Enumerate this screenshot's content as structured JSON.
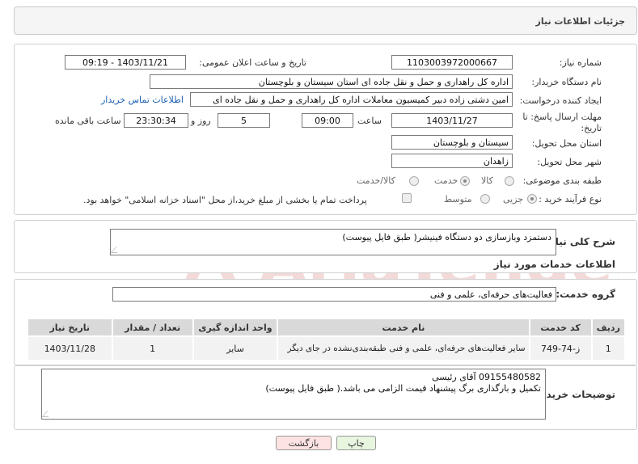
{
  "header": {
    "title": "جزئیات اطلاعات نیاز"
  },
  "form": {
    "need_number_label": "شماره نیاز:",
    "need_number": "1103003972000667",
    "announce_label": "تاریخ و ساعت اعلان عمومی:",
    "announce_value": "1403/11/21 - 09:19",
    "buyer_org_label": "نام دستگاه خریدار:",
    "buyer_org": "اداره کل راهداری و حمل و نقل جاده ای استان سیستان و بلوچستان",
    "requester_label": "ایجاد کننده درخواست:",
    "requester": "امین دشتی زاده دبیر کمیسیون معاملات اداره کل راهداری و حمل و نقل جاده ای",
    "contact_link": "اطلاعات تماس خریدار",
    "deadline_label": "مهلت ارسال پاسخ: تا تاریخ:",
    "deadline_date": "1403/11/27",
    "time_label": "ساعت",
    "deadline_time": "09:00",
    "days_value": "5",
    "days_label": "روز و",
    "remaining_time": "23:30:34",
    "remaining_label": "ساعت باقی مانده",
    "province_label": "استان محل تحویل:",
    "province": "سیستان و بلوچستان",
    "city_label": "شهر محل تحویل:",
    "city": "زاهدان",
    "category_label": "طبقه بندی موضوعی:",
    "category_options": [
      "کالا",
      "خدمت",
      "کالا/خدمت"
    ],
    "category_selected": "خدمت",
    "process_label": "نوع فرآیند خرید :",
    "process_options": [
      "جزیی",
      "متوسط"
    ],
    "process_selected": "جزیی",
    "treasury_note": "پرداخت تمام یا بخشی از مبلغ خرید،از محل \"اسناد خزانه اسلامی\" خواهد بود."
  },
  "summary": {
    "label": "شرح کلی نیاز:",
    "text": "دستمزد وبازسازی دو دستگاه فینیشر( طبق فایل پیوست)"
  },
  "services": {
    "title": "اطلاعات خدمات مورد نیاز",
    "group_label": "گروه خدمت:",
    "group_value": "فعالیت‌های حرفه‌ای، علمی و فنی",
    "columns": [
      "ردیف",
      "کد خدمت",
      "نام خدمت",
      "واحد اندازه گیری",
      "تعداد / مقدار",
      "تاریخ نیاز"
    ],
    "rows": [
      [
        "1",
        "ز-74-749",
        "سایر فعالیت‌های حرفه‌ای، علمی و فنی طبقه‌بندی‌نشده در جای دیگر",
        "سایر",
        "1",
        "1403/11/28"
      ]
    ]
  },
  "buyer_notes": {
    "label": "توضیحات خریدار:",
    "line1": "09155480582 آقای رئیسی",
    "line2": "تکمیل و بارگذاری برگ پیشنهاد قیمت الزامی می باشد.( طبق فایل پیوست)"
  },
  "buttons": {
    "print": "چاپ",
    "back": "بازگشت"
  },
  "watermark": {
    "text": "AriaTender.neT"
  },
  "colors": {
    "link": "#1a5fb4",
    "watermark": "#c0392b"
  }
}
